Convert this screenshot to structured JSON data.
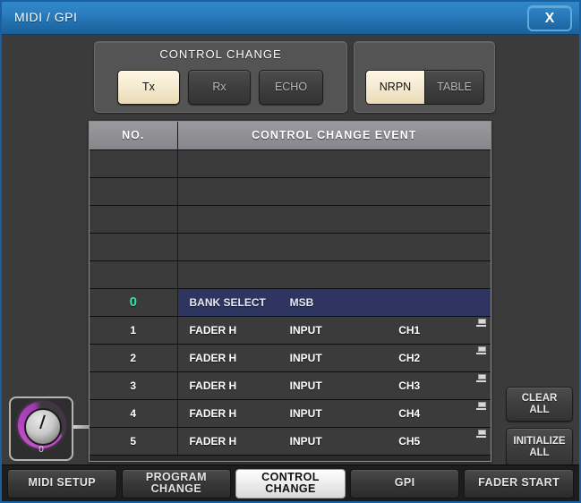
{
  "window": {
    "title": "MIDI / GPI",
    "close_label": "X"
  },
  "control_change_panel": {
    "title": "CONTROL CHANGE",
    "buttons": [
      {
        "label": "Tx",
        "active": true
      },
      {
        "label": "Rx",
        "active": false
      },
      {
        "label": "ECHO",
        "active": false
      }
    ]
  },
  "mode_panel": {
    "segments": [
      {
        "label": "NRPN",
        "active": true
      },
      {
        "label": "TABLE",
        "active": false
      }
    ]
  },
  "table": {
    "columns": [
      "NO.",
      "CONTROL CHANGE EVENT"
    ],
    "rows": [
      {
        "no": "",
        "f1": "",
        "f2": "",
        "f3": "",
        "selected": false,
        "icon": false
      },
      {
        "no": "",
        "f1": "",
        "f2": "",
        "f3": "",
        "selected": false,
        "icon": false
      },
      {
        "no": "",
        "f1": "",
        "f2": "",
        "f3": "",
        "selected": false,
        "icon": false
      },
      {
        "no": "",
        "f1": "",
        "f2": "",
        "f3": "",
        "selected": false,
        "icon": false
      },
      {
        "no": "",
        "f1": "",
        "f2": "",
        "f3": "",
        "selected": false,
        "icon": false
      },
      {
        "no": "0",
        "f1": "BANK SELECT",
        "f2": "MSB",
        "f3": "",
        "selected": true,
        "icon": false
      },
      {
        "no": "1",
        "f1": "FADER H",
        "f2": "INPUT",
        "f3": "CH1",
        "selected": false,
        "icon": true
      },
      {
        "no": "2",
        "f1": "FADER H",
        "f2": "INPUT",
        "f3": "CH2",
        "selected": false,
        "icon": true
      },
      {
        "no": "3",
        "f1": "FADER H",
        "f2": "INPUT",
        "f3": "CH3",
        "selected": false,
        "icon": true
      },
      {
        "no": "4",
        "f1": "FADER H",
        "f2": "INPUT",
        "f3": "CH4",
        "selected": false,
        "icon": true
      },
      {
        "no": "5",
        "f1": "FADER H",
        "f2": "INPUT",
        "f3": "CH5",
        "selected": false,
        "icon": true
      }
    ]
  },
  "side_buttons": {
    "clear_all_line1": "CLEAR",
    "clear_all_line2": "ALL",
    "initialize_all_line1": "INITIALIZE",
    "initialize_all_line2": "ALL"
  },
  "knob": {
    "value": "0"
  },
  "tabs": [
    {
      "line1": "MIDI SETUP",
      "line2": "",
      "active": false
    },
    {
      "line1": "PROGRAM",
      "line2": "CHANGE",
      "active": false
    },
    {
      "line1": "CONTROL",
      "line2": "CHANGE",
      "active": true
    },
    {
      "line1": "GPI",
      "line2": "",
      "active": false
    },
    {
      "line1": "FADER START",
      "line2": "",
      "active": false
    }
  ],
  "colors": {
    "title_bar": "#2b7fc0",
    "active_button": "#f6ecd3",
    "selected_row": "#2e3560",
    "selected_no": "#3adfb0",
    "knob_ring": "#c04ec9"
  }
}
